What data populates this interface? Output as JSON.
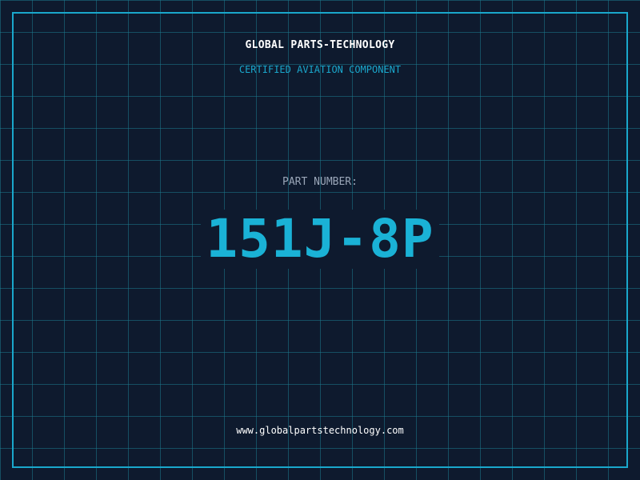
{
  "brand": {
    "name": "GLOBAL PARTS-TECHNOLOGY",
    "tagline": "CERTIFIED AVIATION COMPONENT"
  },
  "part": {
    "label": "PART NUMBER:",
    "number": "151J-8P"
  },
  "footer": {
    "url": "www.globalpartstechnology.com"
  },
  "colors": {
    "background": "#0e1a2e",
    "accent": "#1aa7cc",
    "grid": "#1e788c"
  }
}
